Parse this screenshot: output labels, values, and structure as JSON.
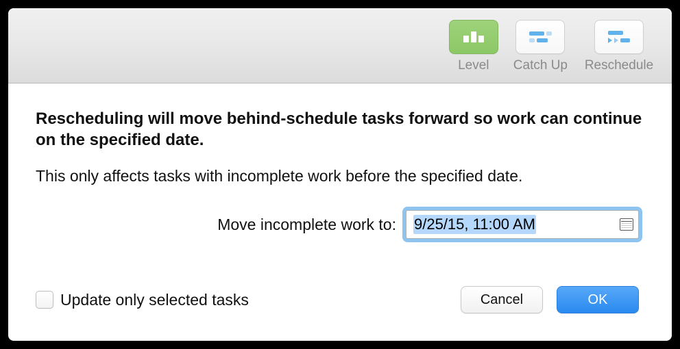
{
  "toolbar": {
    "level_label": "Level",
    "catchup_label": "Catch Up",
    "reschedule_label": "Reschedule"
  },
  "dialog": {
    "headline": "Rescheduling will move behind-schedule tasks forward so work can continue on the specified date.",
    "subtext": "This only affects tasks with incomplete work before the specified date.",
    "field_label": "Move incomplete work to:",
    "date_value": "9/25/15, 11:00 AM",
    "checkbox_label": "Update only selected tasks",
    "checkbox_checked": false,
    "cancel_label": "Cancel",
    "ok_label": "OK"
  }
}
